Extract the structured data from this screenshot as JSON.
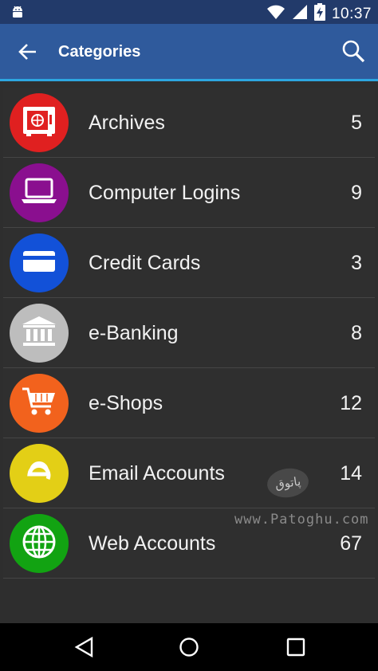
{
  "status_bar": {
    "time": "10:37",
    "icons": [
      "android-icon",
      "wifi-icon",
      "signal-icon",
      "battery-charging-icon"
    ]
  },
  "app_bar": {
    "title": "Categories",
    "back_icon": "arrow-left-icon",
    "search_icon": "search-icon",
    "color": "#2f5a9c",
    "accent": "#2da6e0"
  },
  "categories": [
    {
      "label": "Archives",
      "count": "5",
      "color": "#e02020",
      "icon": "safe-icon"
    },
    {
      "label": "Computer Logins",
      "count": "9",
      "color": "#8a0f8f",
      "icon": "laptop-icon"
    },
    {
      "label": "Credit Cards",
      "count": "3",
      "color": "#1251d8",
      "icon": "credit-card-icon"
    },
    {
      "label": "e-Banking",
      "count": "8",
      "color": "#bdbdbd",
      "icon": "bank-icon"
    },
    {
      "label": "e-Shops",
      "count": "12",
      "color": "#f2621d",
      "icon": "shopping-cart-icon"
    },
    {
      "label": "Email Accounts",
      "count": "14",
      "color": "#e3cf16",
      "icon": "email-e-icon"
    },
    {
      "label": "Web Accounts",
      "count": "67",
      "color": "#12a312",
      "icon": "globe-icon"
    }
  ],
  "watermark": {
    "text": "www.Patoghu.com",
    "logo_text": "پاتوق"
  },
  "nav_bar": {
    "icons": [
      "back-triangle-icon",
      "home-circle-icon",
      "recents-square-icon"
    ]
  }
}
